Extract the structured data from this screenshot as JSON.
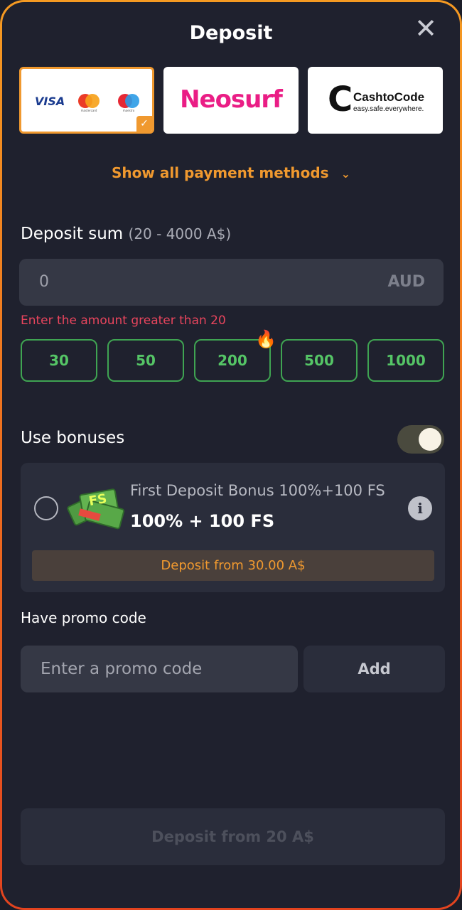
{
  "header": {
    "title": "Deposit",
    "close_icon": "close-icon"
  },
  "payment_methods": {
    "card": {
      "visa": "VISA",
      "mastercard_caption": "mastercard",
      "maestro_caption": "maestro",
      "selected": true
    },
    "neosurf": {
      "label": "Neosurf"
    },
    "cashtocode": {
      "name": "CashtoCode",
      "tagline": "easy.safe.everywhere."
    },
    "show_all_label": "Show all payment methods"
  },
  "deposit_sum": {
    "label": "Deposit sum",
    "range": "(20 - 4000 A$)",
    "value": "0",
    "currency": "AUD",
    "error": "Enter the amount greater than 20",
    "quick_amounts": [
      "30",
      "50",
      "200",
      "500",
      "1000"
    ],
    "hot_amount": "200"
  },
  "bonuses": {
    "label": "Use bonuses",
    "enabled": true,
    "card": {
      "name": "First Deposit Bonus 100%+100 FS",
      "value": "100% + 100 FS",
      "badge_text": "FS",
      "min_deposit": "Deposit from 30.00 A$"
    }
  },
  "promo": {
    "label": "Have promo code",
    "placeholder": "Enter a promo code",
    "add_label": "Add"
  },
  "submit": {
    "label": "Deposit from 20 A$"
  },
  "colors": {
    "accent": "#f0992f",
    "success": "#3fa452",
    "error": "#e8455d",
    "background": "#1f212e"
  }
}
